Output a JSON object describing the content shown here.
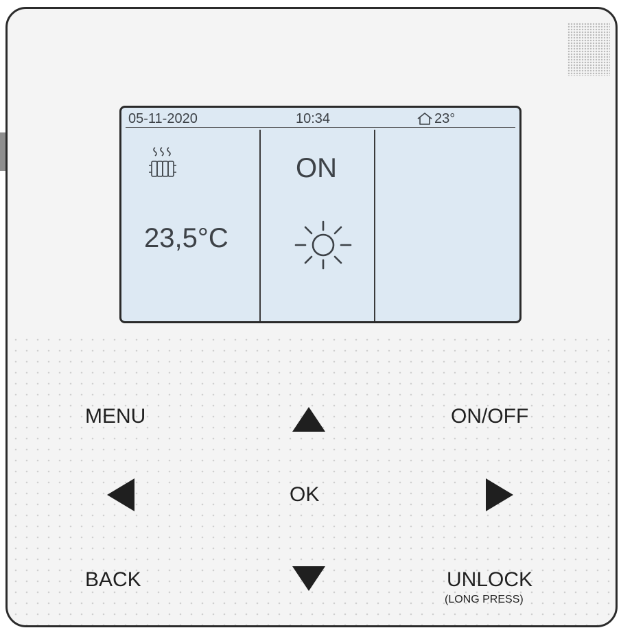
{
  "screen": {
    "date": "05-11-2020",
    "time": "10:34",
    "room_temp": "23°",
    "zone_temp": "23,5°C",
    "mode_status": "ON"
  },
  "icons": {
    "home": "home-icon",
    "radiator": "radiator-heating-icon",
    "sun": "sun-icon",
    "arrows": [
      "arrow-up-icon",
      "arrow-down-icon",
      "arrow-left-icon",
      "arrow-right-icon"
    ]
  },
  "buttons": {
    "menu": "MENU",
    "on_off": "ON/OFF",
    "ok": "OK",
    "back": "BACK",
    "unlock": "UNLOCK",
    "unlock_hint": "(LONG PRESS)"
  },
  "colors": {
    "lcd_background": "#dde9f3",
    "lcd_text": "#3d4247",
    "panel": "#f4f4f4",
    "frame": "#2b2b2b",
    "button_text": "#1f1f1f"
  }
}
